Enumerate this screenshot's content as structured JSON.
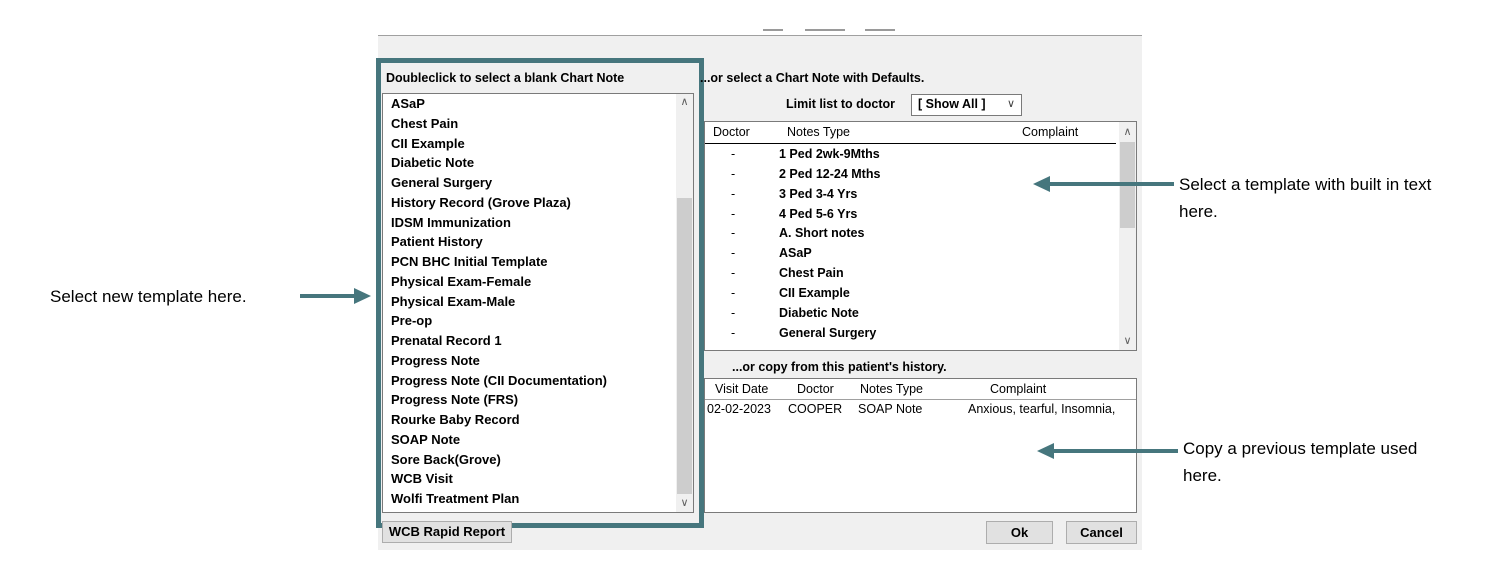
{
  "dialog": {
    "left_header": "Doubleclick to select a blank Chart Note",
    "right_header": "...or select a Chart Note with Defaults.",
    "limit_label": "Limit list to doctor",
    "limit_value": "[ Show All ]",
    "history_header": "...or copy from this patient's history.",
    "wcb_button": "WCB Rapid Report",
    "ok_button": "Ok",
    "cancel_button": "Cancel"
  },
  "blank_templates": [
    "ASaP",
    "Chest Pain",
    "CII Example",
    "Diabetic Note",
    "General Surgery",
    "History Record (Grove Plaza)",
    "IDSM Immunization",
    "Patient History",
    "PCN BHC Initial Template",
    "Physical Exam-Female",
    "Physical Exam-Male",
    "Pre-op",
    "Prenatal Record 1",
    "Progress Note",
    "Progress Note (CII Documentation)",
    "Progress Note (FRS)",
    "Rourke Baby Record",
    "SOAP Note",
    "Sore Back(Grove)",
    "WCB Visit",
    "Wolfi Treatment Plan"
  ],
  "defaults_table": {
    "columns": [
      "Doctor",
      "Notes Type",
      "Complaint"
    ],
    "rows": [
      {
        "doctor": "-",
        "type": "1 Ped 2wk-9Mths"
      },
      {
        "doctor": "-",
        "type": "2 Ped 12-24 Mths"
      },
      {
        "doctor": "-",
        "type": "3 Ped 3-4 Yrs"
      },
      {
        "doctor": "-",
        "type": "4 Ped 5-6 Yrs"
      },
      {
        "doctor": "-",
        "type": "A. Short notes"
      },
      {
        "doctor": "-",
        "type": "ASaP"
      },
      {
        "doctor": "-",
        "type": "Chest Pain"
      },
      {
        "doctor": "-",
        "type": "CII Example"
      },
      {
        "doctor": "-",
        "type": "Diabetic Note"
      },
      {
        "doctor": "-",
        "type": "General Surgery"
      }
    ]
  },
  "history_table": {
    "columns": [
      "Visit Date",
      "Doctor",
      "Notes Type",
      "Complaint"
    ],
    "rows": [
      {
        "date": "02-02-2023",
        "doctor": "COOPER",
        "type": "SOAP Note",
        "complaint": "Anxious, tearful, Insomnia,"
      }
    ]
  },
  "callouts": {
    "left": "Select new template here.",
    "top_right_1": "Select a template with built in text",
    "top_right_2": "here.",
    "bottom_right_1": "Copy a previous template used",
    "bottom_right_2": "here."
  },
  "colors": {
    "accent": "#46767d",
    "dialog_bg": "#f0f0f0"
  }
}
